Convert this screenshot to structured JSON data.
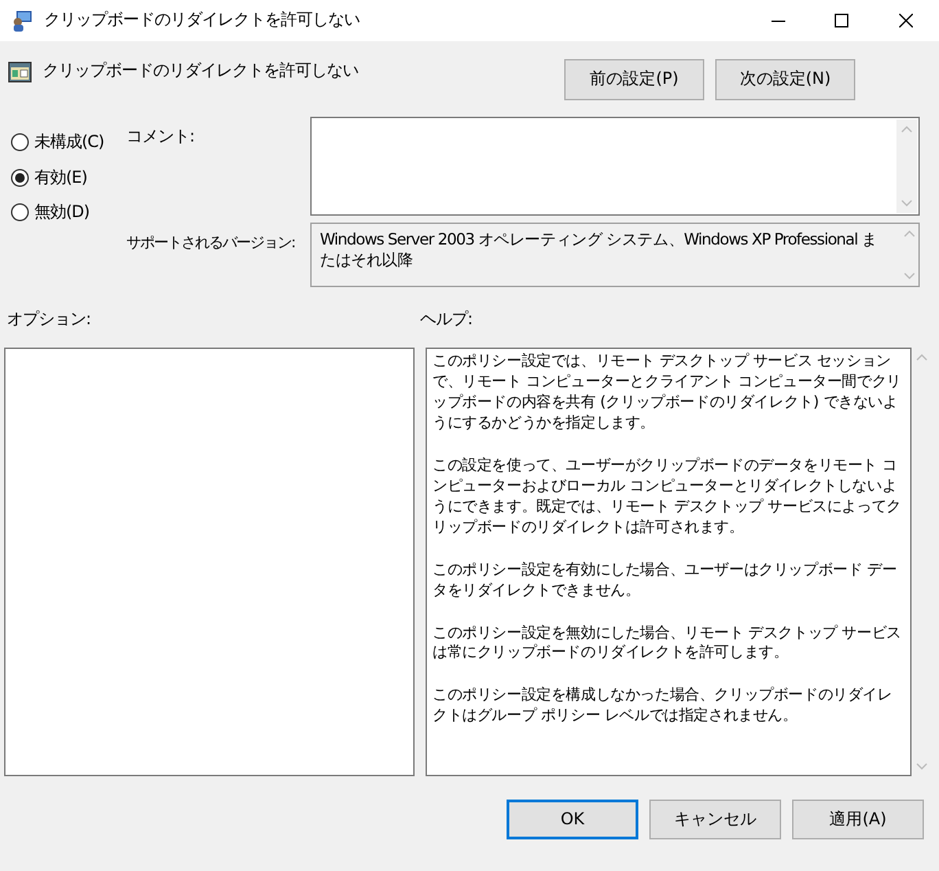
{
  "window": {
    "title": "クリップボードのリダイレクトを許可しない"
  },
  "policy": {
    "title": "クリップボードのリダイレクトを許可しない"
  },
  "nav_buttons": [
    {
      "label": "前の設定(P)"
    },
    {
      "label": "次の設定(N)"
    }
  ],
  "state_options": [
    {
      "label": "未構成(C)",
      "selected": false
    },
    {
      "label": "有効(E)",
      "selected": true
    },
    {
      "label": "無効(D)",
      "selected": false
    }
  ],
  "comment": {
    "label": "コメント:"
  },
  "supported": {
    "label": "サポートされるバージョン:",
    "value": "Windows Server 2003 オペレーティング システム、Windows XP Professional またはそれ以降"
  },
  "options": {
    "label": "オプション:"
  },
  "help": {
    "label": "ヘルプ:",
    "paragraphs": [
      "このポリシー設定では、リモート デスクトップ サービス セッションで、リモート コンピューターとクライアント コンピューター間でクリップボードの内容を共有 (クリップボードのリダイレクト) できないようにするかどうかを指定します。",
      "この設定を使って、ユーザーがクリップボードのデータをリモート コンピューターおよびローカル コンピューターとリダイレクトしないようにできます。既定では、リモート デスクトップ サービスによってクリップボードのリダイレクトは許可されます。",
      "このポリシー設定を有効にした場合、ユーザーはクリップボード データをリダイレクトできません。",
      "このポリシー設定を無効にした場合、リモート デスクトップ サービスは常にクリップボードのリダイレクトを許可します。",
      "このポリシー設定を構成しなかった場合、クリップボードのリダイレクトはグループ ポリシー レベルでは指定されません。"
    ]
  },
  "buttons": [
    {
      "label": "OK",
      "default": true
    },
    {
      "label": "キャンセル",
      "default": false
    },
    {
      "label": "適用(A)",
      "default": false
    }
  ]
}
